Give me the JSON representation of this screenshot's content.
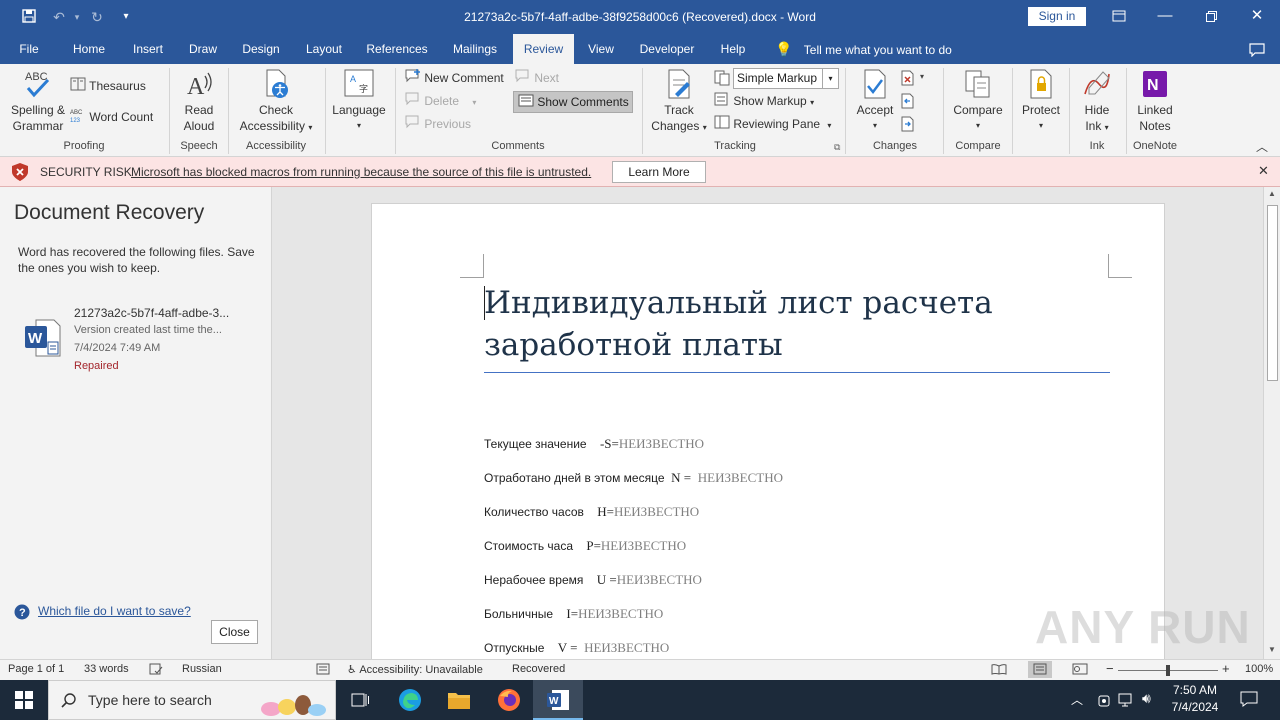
{
  "titlebar": {
    "title": "21273a2c-5b7f-4aff-adbe-38f9258d00c6 (Recovered).docx  -  Word",
    "sign_in": "Sign in"
  },
  "tabs": [
    "File",
    "Home",
    "Insert",
    "Draw",
    "Design",
    "Layout",
    "References",
    "Mailings",
    "Review",
    "View",
    "Developer",
    "Help"
  ],
  "active_tab": "Review",
  "tell_me": "Tell me what you want to do",
  "ribbon": {
    "spelling": "Spelling &",
    "grammar": "Grammar",
    "thesaurus": "Thesaurus",
    "word_count": "Word Count",
    "read": "Read",
    "aloud": "Aloud",
    "check": "Check",
    "accessibility": "Accessibility",
    "language": "Language",
    "new_comment": "New Comment",
    "delete": "Delete",
    "previous": "Previous",
    "next": "Next",
    "show_comments": "Show Comments",
    "track": "Track",
    "changes": "Changes",
    "simple_markup": "Simple Markup",
    "show_markup": "Show Markup",
    "reviewing_pane": "Reviewing Pane",
    "accept": "Accept",
    "compare": "Compare",
    "protect": "Protect",
    "hide": "Hide",
    "ink": "Ink",
    "linked": "Linked",
    "notes": "Notes",
    "groups": {
      "proofing": "Proofing",
      "speech": "Speech",
      "accessibility": "Accessibility",
      "comments": "Comments",
      "tracking": "Tracking",
      "changes": "Changes",
      "compare": "Compare",
      "ink": "Ink",
      "onenote": "OneNote"
    }
  },
  "message_bar": {
    "risk": "SECURITY RISK",
    "message": "Microsoft has blocked macros from running because the source of this file is untrusted.",
    "learn_more": "Learn More"
  },
  "recovery": {
    "title": "Document Recovery",
    "description": "Word has recovered the following files. Save the ones you wish to keep.",
    "file_name": "21273a2c-5b7f-4aff-adbe-3...",
    "file_desc": "Version created last time the...",
    "file_date": "7/4/2024 7:49 AM",
    "file_status": "Repaired",
    "help_link": "Which file do I want to save?",
    "close": "Close"
  },
  "document": {
    "title": "Индивидуальный лист расчета заработной платы",
    "fields": [
      {
        "label": "Текущее значение",
        "eq": "-S=",
        "value": "НЕИЗВЕСТНО"
      },
      {
        "label": "Отработано дней в этом месяце",
        "eq": "N = ",
        "value": "НЕИЗВЕСТНО"
      },
      {
        "label": "Количество часов",
        "eq": "H=",
        "value": "НЕИЗВЕСТНО"
      },
      {
        "label": "Стоимость часа",
        "eq": "P=",
        "value": "НЕИЗВЕСТНО"
      },
      {
        "label": "Нерабочее время",
        "eq": "U =",
        "value": "НЕИЗВЕСТНО"
      },
      {
        "label": "Больничные",
        "eq": "I=",
        "value": "НЕИЗВЕСТНО"
      },
      {
        "label": "Отпускные",
        "eq": "V = ",
        "value": "НЕИЗВЕСТНО"
      }
    ]
  },
  "statusbar": {
    "page": "Page 1 of 1",
    "words": "33 words",
    "language": "Russian",
    "accessibility": "Accessibility: Unavailable",
    "recovered": "Recovered",
    "zoom": "100%"
  },
  "taskbar": {
    "search_placeholder": "Type here to search",
    "time": "7:50 AM",
    "date": "7/4/2024"
  },
  "watermark": "ANY RUN",
  "colors": {
    "word_blue": "#2b579a",
    "security_bg": "#fce4e4",
    "repaired": "#a4262c"
  }
}
